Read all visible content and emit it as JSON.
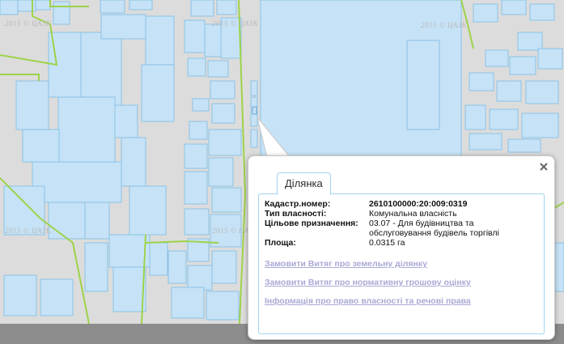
{
  "map": {
    "watermark_text": "2015 © ЦАЗК"
  },
  "popup": {
    "tab_label": "Ділянка",
    "close_icon": "close-icon",
    "fields": [
      {
        "label": "Кадастр.номер:",
        "value": "2610100000:20:009:0319"
      },
      {
        "label": "Тип власності:",
        "value": "Комунальна власність"
      },
      {
        "label": "Цільове призначення:",
        "value": "03.07 - Для будівництва та обслуговування будівель торгівлі"
      },
      {
        "label": "Площа:",
        "value": "0.0315 га"
      }
    ],
    "links": [
      "Замовити Витяг про земельну ділянку",
      "Замовити Витяг про нормативну грошову оцінку",
      "Інформація про право власності та речові права"
    ]
  },
  "colors": {
    "parcel_fill": "#c6e2f6",
    "parcel_stroke": "#8bc3e6",
    "boundary_line": "#9dd34a",
    "background": "#dcdcdc",
    "link": "#a9a9d6"
  }
}
